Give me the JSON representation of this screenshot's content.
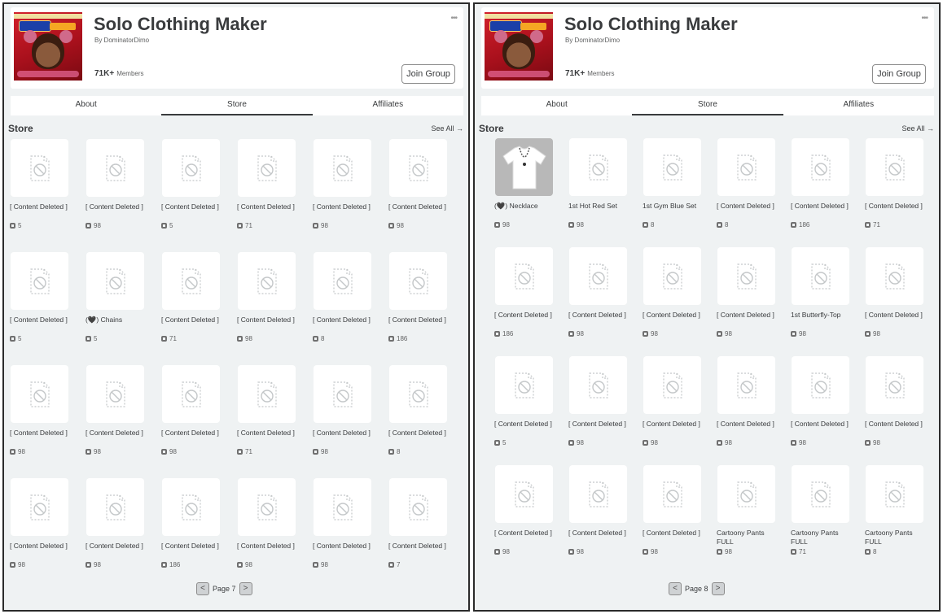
{
  "screens": [
    {
      "group": {
        "title": "Solo Clothing Maker",
        "byline": "By DominatorDimo",
        "members_count": "71K+",
        "members_label": "Members",
        "join_label": "Join Group",
        "more_icon": "•••"
      },
      "tabs": [
        "About",
        "Store",
        "Affiliates"
      ],
      "active_tab": 1,
      "store": {
        "title": "Store",
        "see_all": "See All →",
        "items": [
          {
            "name": "[ Content Deleted ]",
            "price": "5"
          },
          {
            "name": "[ Content Deleted ]",
            "price": "98"
          },
          {
            "name": "[ Content Deleted ]",
            "price": "5"
          },
          {
            "name": "[ Content Deleted ]",
            "price": "71"
          },
          {
            "name": "[ Content Deleted ]",
            "price": "98"
          },
          {
            "name": "[ Content Deleted ]",
            "price": "98"
          },
          {
            "name": "[ Content Deleted ]",
            "price": "5"
          },
          {
            "name": "(🖤) Chains",
            "price": "5"
          },
          {
            "name": "[ Content Deleted ]",
            "price": "71"
          },
          {
            "name": "[ Content Deleted ]",
            "price": "98"
          },
          {
            "name": "[ Content Deleted ]",
            "price": "8"
          },
          {
            "name": "[ Content Deleted ]",
            "price": "186"
          },
          {
            "name": "[ Content Deleted ]",
            "price": "98"
          },
          {
            "name": "[ Content Deleted ]",
            "price": "98"
          },
          {
            "name": "[ Content Deleted ]",
            "price": "98"
          },
          {
            "name": "[ Content Deleted ]",
            "price": "71"
          },
          {
            "name": "[ Content Deleted ]",
            "price": "98"
          },
          {
            "name": "[ Content Deleted ]",
            "price": "8"
          },
          {
            "name": "[ Content Deleted ]",
            "price": "98"
          },
          {
            "name": "[ Content Deleted ]",
            "price": "98"
          },
          {
            "name": "[ Content Deleted ]",
            "price": "186"
          },
          {
            "name": "[ Content Deleted ]",
            "price": "98"
          },
          {
            "name": "[ Content Deleted ]",
            "price": "98"
          },
          {
            "name": "[ Content Deleted ]",
            "price": "7"
          }
        ]
      },
      "pager": {
        "prev": "<",
        "label": "Page 7",
        "next": ">"
      }
    },
    {
      "group": {
        "title": "Solo Clothing Maker",
        "byline": "By DominatorDimo",
        "members_count": "71K+",
        "members_label": "Members",
        "join_label": "Join Group",
        "more_icon": "•••"
      },
      "tabs": [
        "About",
        "Store",
        "Affiliates"
      ],
      "active_tab": 1,
      "store": {
        "title": "Store",
        "see_all": "See All →",
        "items": [
          {
            "name": "(🖤) Necklace",
            "price": "98",
            "thumb": "shirt-with-chain"
          },
          {
            "name": "1st Hot Red Set",
            "price": "98"
          },
          {
            "name": "1st Gym Blue Set",
            "price": "8"
          },
          {
            "name": "[ Content Deleted ]",
            "price": "8"
          },
          {
            "name": "[ Content Deleted ]",
            "price": "186"
          },
          {
            "name": "[ Content Deleted ]",
            "price": "71"
          },
          {
            "name": "[ Content Deleted ]",
            "price": "186"
          },
          {
            "name": "[ Content Deleted ]",
            "price": "98"
          },
          {
            "name": "[ Content Deleted ]",
            "price": "98"
          },
          {
            "name": "[ Content Deleted ]",
            "price": "98"
          },
          {
            "name": "1st Butterfly-Top",
            "price": "98"
          },
          {
            "name": "[ Content Deleted ]",
            "price": "98"
          },
          {
            "name": "[ Content Deleted ]",
            "price": "5"
          },
          {
            "name": "[ Content Deleted ]",
            "price": "98"
          },
          {
            "name": "[ Content Deleted ]",
            "price": "98"
          },
          {
            "name": "[ Content Deleted ]",
            "price": "98"
          },
          {
            "name": "[ Content Deleted ]",
            "price": "98"
          },
          {
            "name": "[ Content Deleted ]",
            "price": "98"
          },
          {
            "name": "[ Content Deleted ]",
            "price": "98"
          },
          {
            "name": "[ Content Deleted ]",
            "price": "98"
          },
          {
            "name": "[ Content Deleted ]",
            "price": "98"
          },
          {
            "name": "Cartoony Pants FULL",
            "price": "98"
          },
          {
            "name": "Cartoony Pants FULL",
            "price": "71"
          },
          {
            "name": "Cartoony Pants FULL",
            "price": "8"
          }
        ]
      },
      "pager": {
        "prev": "<",
        "label": "Page 8",
        "next": ">"
      }
    }
  ]
}
